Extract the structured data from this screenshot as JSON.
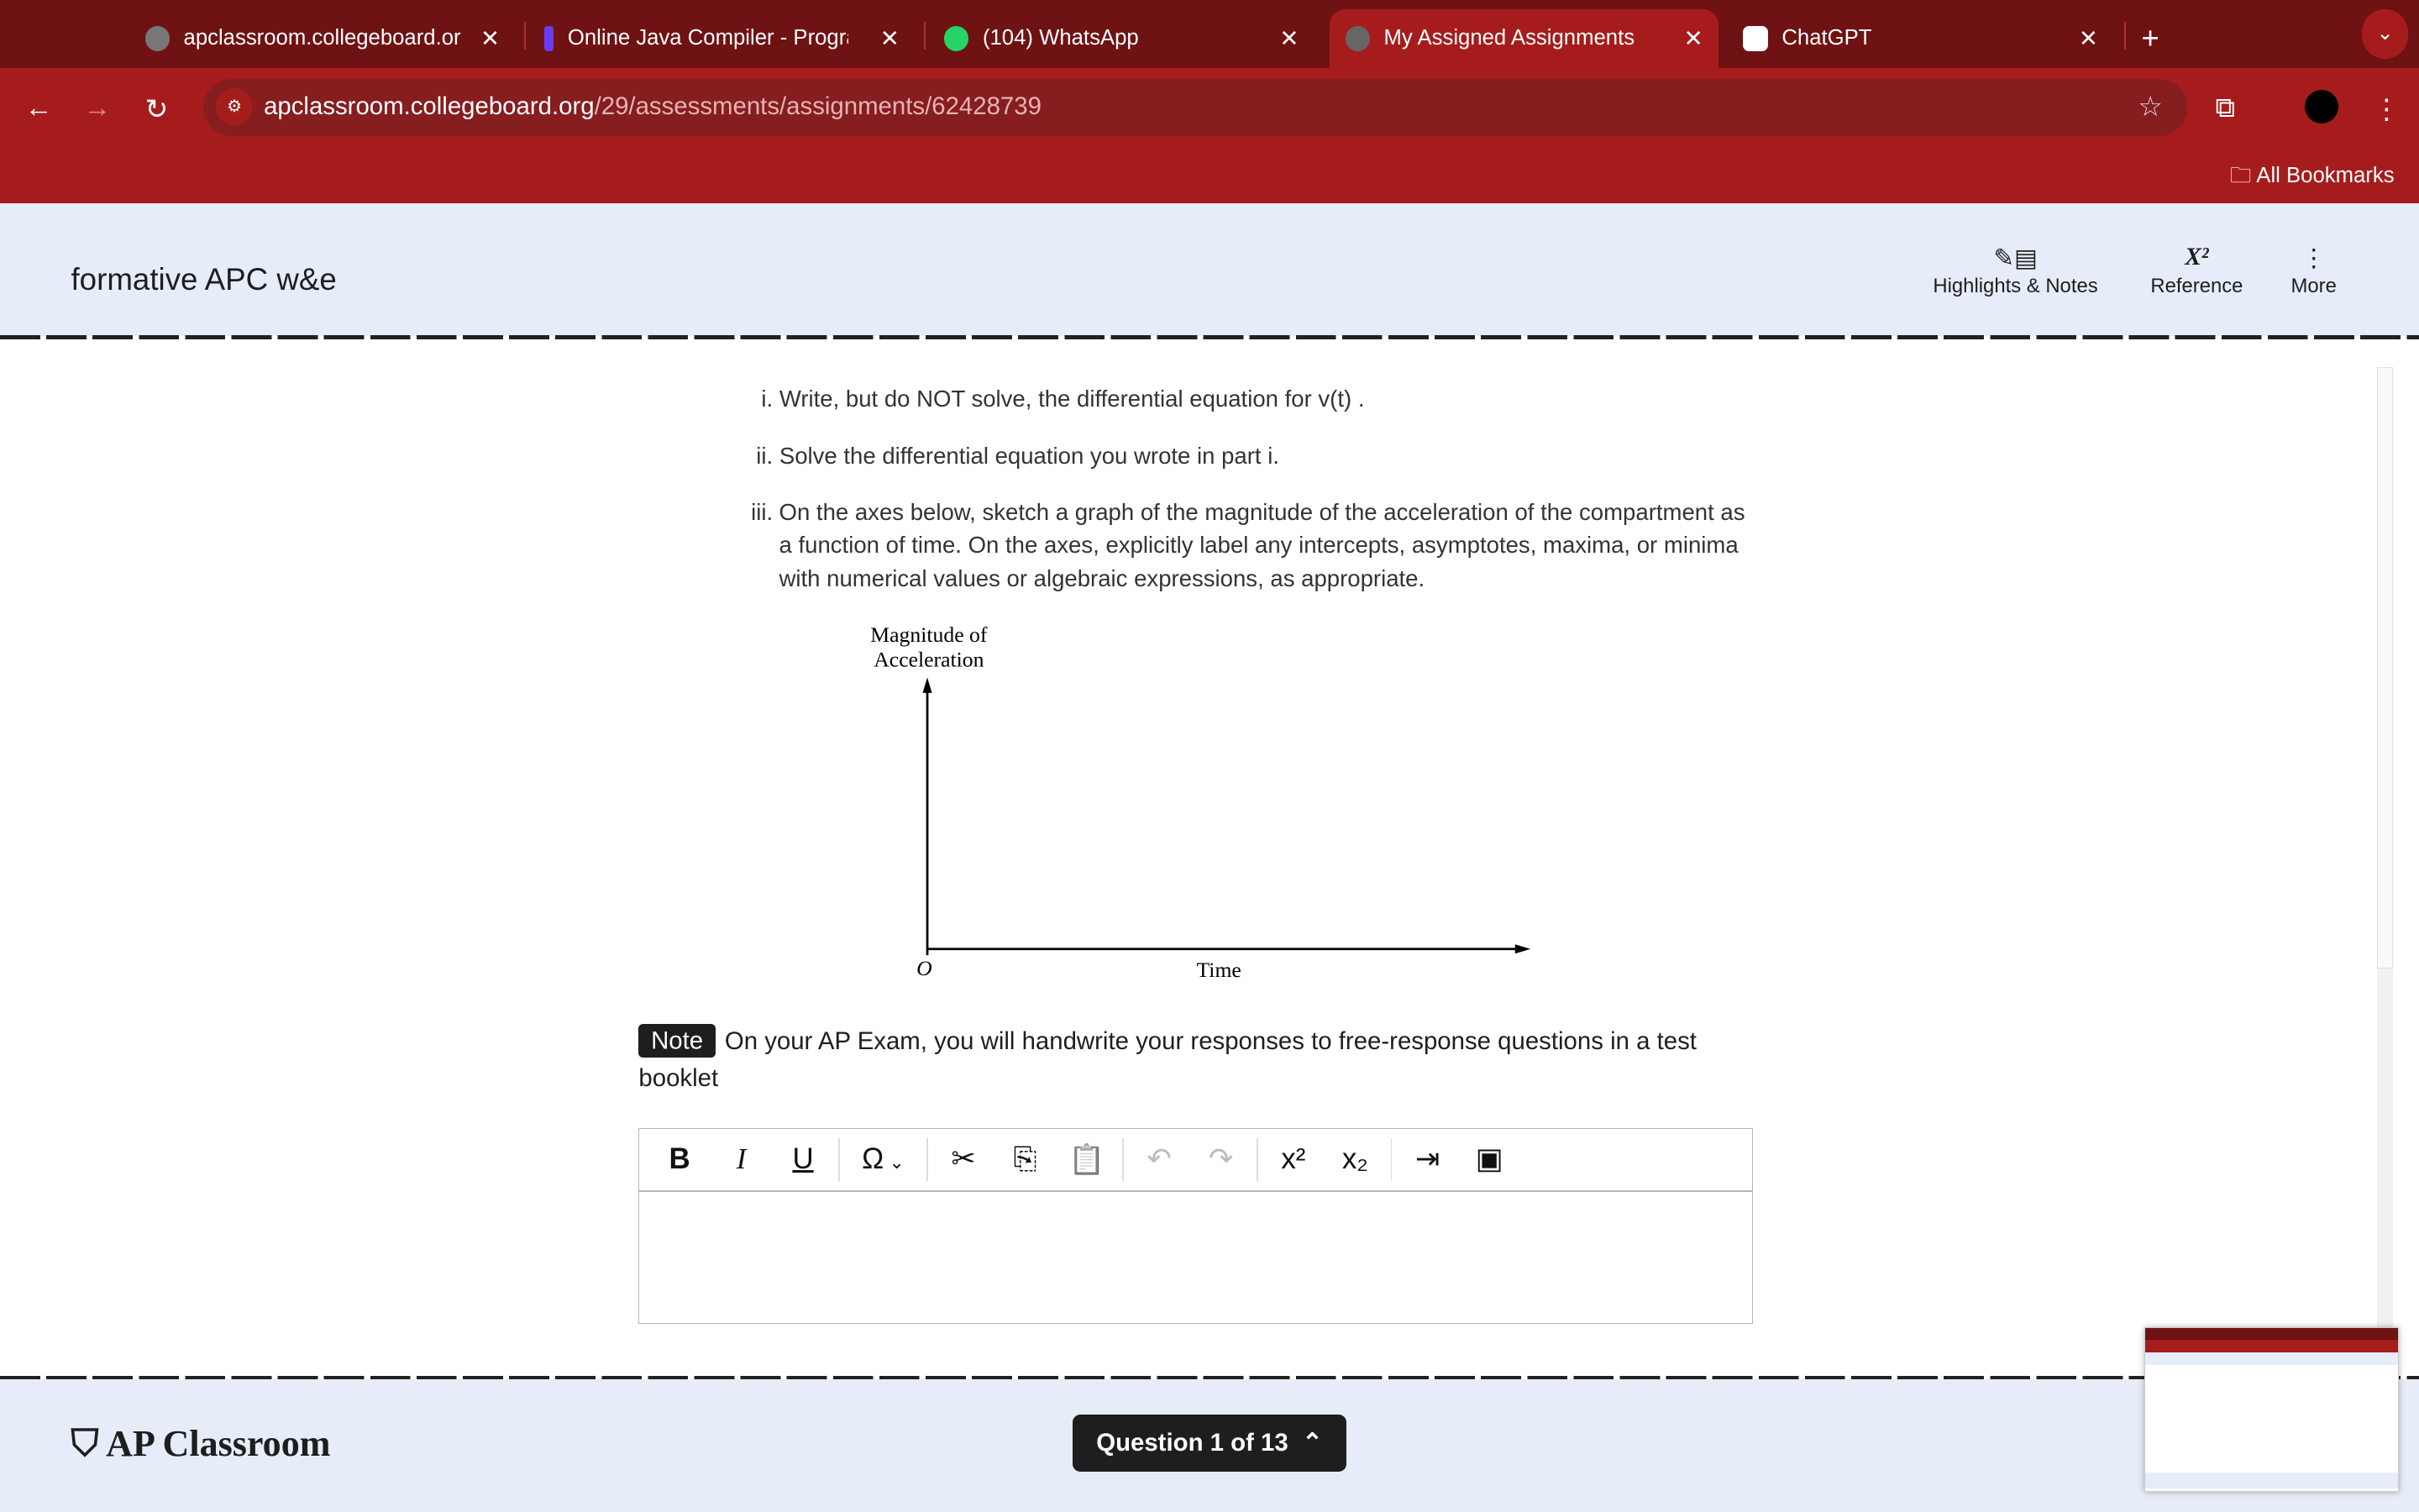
{
  "browser": {
    "tabs": [
      {
        "label": "apclassroom.collegeboard.org",
        "active": false
      },
      {
        "label": "Online Java Compiler - Progra",
        "active": false
      },
      {
        "label": "(104) WhatsApp",
        "active": false
      },
      {
        "label": "My Assigned Assignments",
        "active": true
      },
      {
        "label": "ChatGPT",
        "active": false
      }
    ],
    "new_tab": "+",
    "url_host": "apclassroom.collegeboard.org",
    "url_path": "/29/assessments/assignments/62428739",
    "bookmarks_label": "All Bookmarks"
  },
  "header": {
    "title": "formative APC w&e",
    "tools": [
      {
        "label": "Highlights & Notes",
        "icon": "highlight-notes-icon"
      },
      {
        "label": "Reference",
        "icon": "formula-icon"
      },
      {
        "label": "More",
        "icon": "more-vertical-icon"
      }
    ]
  },
  "question": {
    "parts": [
      {
        "num": "i.",
        "text": "Write, but do NOT solve, the differential equation for v(t) ."
      },
      {
        "num": "ii.",
        "text": "Solve the differential equation you wrote in part i."
      },
      {
        "num": "iii.",
        "text": "On the axes below, sketch a graph of the magnitude of the acceleration of the compartment as a function of time. On the axes, explicitly label any intercepts, asymptotes, maxima, or minima with numerical values or algebraic expressions, as appropriate."
      }
    ],
    "graph": {
      "ylabel1": "Magnitude of",
      "ylabel2": "Acceleration",
      "xlabel": "Time",
      "origin": "O"
    },
    "note_badge": "Note",
    "note_text": "On your AP Exam, you will handwrite your responses to free-response questions in a test booklet"
  },
  "editor": {
    "buttons": [
      "B",
      "I",
      "U",
      "Ω",
      "✂",
      "⎘",
      "📋",
      "↶",
      "↷",
      "x²",
      "x₂",
      "⇥",
      "▣"
    ]
  },
  "footer": {
    "logo": "AP Classroom",
    "question_nav": "Question 1 of 13"
  },
  "colors": {
    "tabbar": "#6e1213",
    "toolbar": "#a61c1c",
    "appbar": "#e7edf8"
  }
}
